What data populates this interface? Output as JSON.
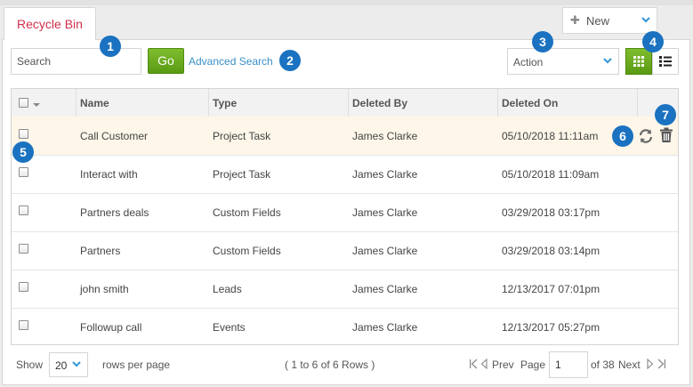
{
  "tab": {
    "label": "Recycle Bin"
  },
  "new_button": {
    "label": "New"
  },
  "search": {
    "placeholder": "Search",
    "go_label": "Go",
    "advanced_label": "Advanced Search"
  },
  "action_select": {
    "value": "Action"
  },
  "badges": [
    "1",
    "2",
    "3",
    "4",
    "5",
    "6",
    "7"
  ],
  "columns": [
    "Name",
    "Type",
    "Deleted By",
    "Deleted On"
  ],
  "rows": [
    {
      "name": "Call Customer",
      "type": "Project Task",
      "deleted_by": "James Clarke",
      "deleted_on": "05/10/2018 11:11am"
    },
    {
      "name": "Interact with",
      "type": "Project Task",
      "deleted_by": "James Clarke",
      "deleted_on": "05/10/2018 11:09am"
    },
    {
      "name": "Partners deals",
      "type": "Custom Fields",
      "deleted_by": "James Clarke",
      "deleted_on": "03/29/2018 03:17pm"
    },
    {
      "name": "Partners",
      "type": "Custom Fields",
      "deleted_by": "James Clarke",
      "deleted_on": "03/29/2018 03:14pm"
    },
    {
      "name": "john smith",
      "type": "Leads",
      "deleted_by": "James Clarke",
      "deleted_on": "12/13/2017 07:01pm"
    },
    {
      "name": "Followup call",
      "type": "Events",
      "deleted_by": "James Clarke",
      "deleted_on": "12/13/2017 05:27pm"
    }
  ],
  "footer": {
    "show_label": "Show",
    "rows_per_page_value": "20",
    "rows_per_page_label": "rows per page",
    "range_text": "( 1 to 6 of 6 Rows )",
    "prev_label": "Prev",
    "page_label": "Page",
    "page_value": "1",
    "of_label": "of 38",
    "next_label": "Next"
  },
  "colors": {
    "accent_green": "#6aab1f",
    "tab_red": "#d1304c",
    "link_blue": "#3a8fc8",
    "badge_blue": "#1a72c0",
    "highlight_row": "#fdf6e9"
  },
  "icons": [
    "plus-icon",
    "chevron-down-icon",
    "grid-view-icon",
    "list-view-icon",
    "restore-icon",
    "trash-icon",
    "first-page-icon",
    "prev-page-icon",
    "next-page-icon",
    "last-page-icon"
  ]
}
